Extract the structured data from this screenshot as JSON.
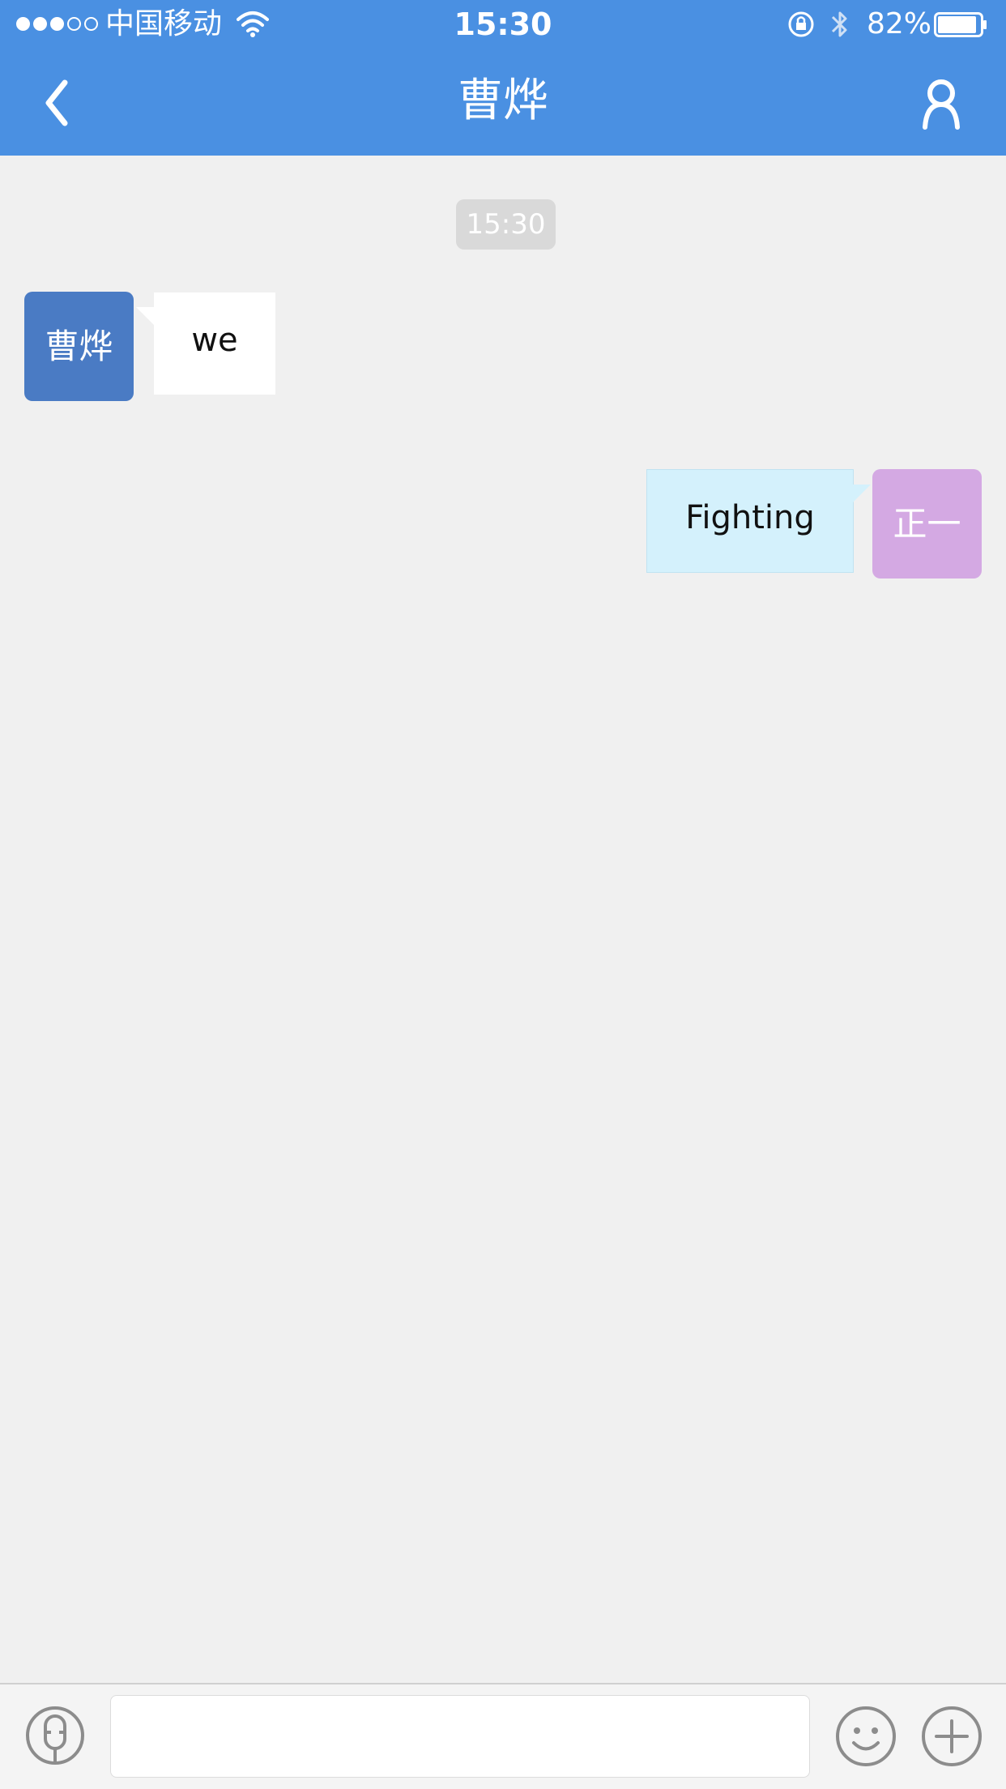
{
  "status_bar": {
    "carrier": "中国移动",
    "time": "15:30",
    "battery_percent": "82%",
    "signal_bars_filled": 3,
    "signal_bars_total": 5
  },
  "nav_bar": {
    "title": "曹烨",
    "back_icon": "chevron-left-icon",
    "profile_icon": "person-icon"
  },
  "chat": {
    "timestamp": "15:30",
    "messages": [
      {
        "side": "left",
        "avatar_text": "曹烨",
        "text": "we"
      },
      {
        "side": "right",
        "avatar_text": "正一",
        "text": "Fighting"
      }
    ]
  },
  "input_bar": {
    "message_value": "",
    "icons": [
      "voice-icon",
      "emoji-icon",
      "plus-icon"
    ]
  },
  "colors": {
    "header": "#4a90e2",
    "background": "#f0f0f0",
    "avatar_left": "#4a7bc4",
    "avatar_right": "#d4a9e3",
    "bubble_right": "#d4f1fc",
    "time_badge": "#d9d9d9"
  }
}
